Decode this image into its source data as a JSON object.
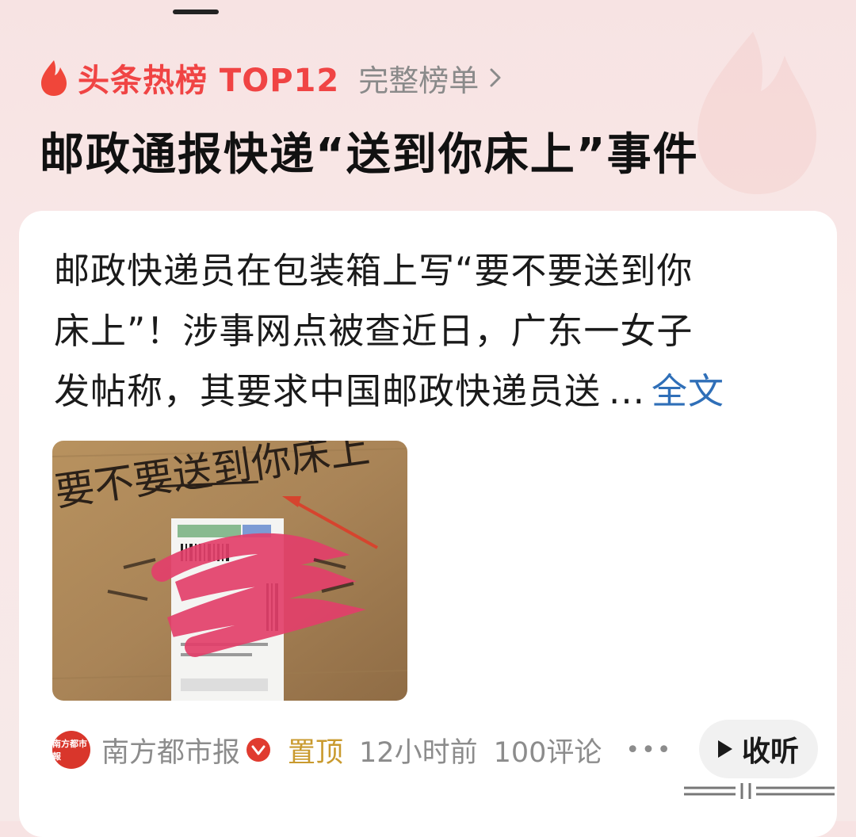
{
  "hot": {
    "title": "头条热榜 TOP12",
    "full_list_label": "完整榜单"
  },
  "headline": "邮政通报快递“送到你床上”事件",
  "article": {
    "summary_lines": [
      "邮政快递员在包装箱上写“要不要送到你",
      "床上”！涉事网点被查近日，广东一女子",
      "发帖称，其要求中国邮政快递员送"
    ],
    "ellipsis": "...",
    "full_text_label": "全文",
    "image_handwriting": "要不要送到你床上"
  },
  "meta": {
    "source": "南方都市报",
    "source_logo_text": "南方都市報",
    "pinned": "置顶",
    "time": "12小时前",
    "comments": "100评论",
    "listen_label": "收听"
  },
  "colors": {
    "accent": "#f04444",
    "link": "#2f6fb8",
    "pinned": "#c99a2e"
  }
}
